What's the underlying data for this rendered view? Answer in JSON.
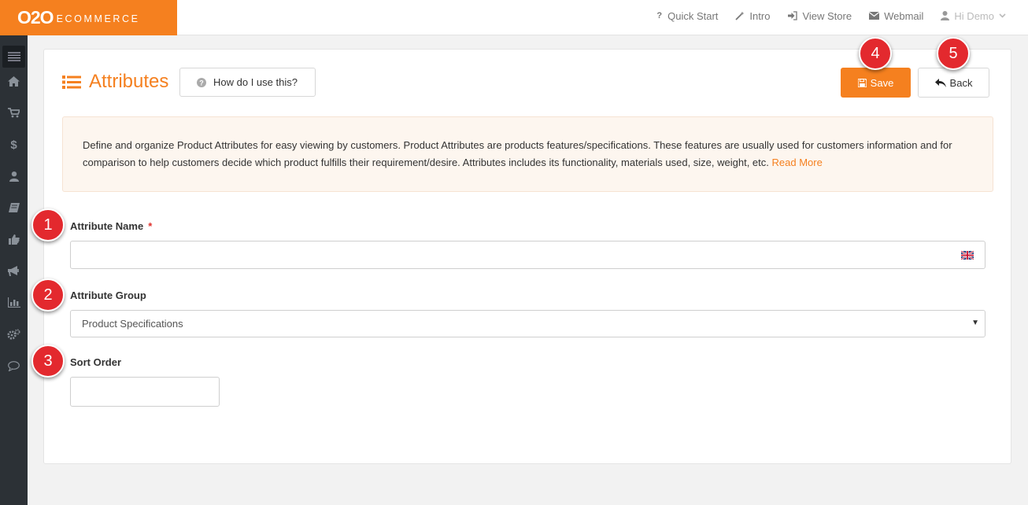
{
  "brand": {
    "main": "O2O",
    "sub": "ECOMMERCE"
  },
  "topnav": {
    "quick_start": "Quick Start",
    "intro": "Intro",
    "view_store": "View Store",
    "webmail": "Webmail",
    "user": "Hi Demo"
  },
  "sidebar": {
    "icons": [
      "menu-icon",
      "home-icon",
      "cart-icon",
      "dollar-icon",
      "user-icon",
      "book-icon",
      "thumbs-up-icon",
      "megaphone-icon",
      "bar-chart-icon",
      "gears-icon",
      "comment-icon"
    ]
  },
  "page": {
    "title": "Attributes",
    "help_label": "How do I use this?",
    "save_label": "Save",
    "back_label": "Back"
  },
  "info": {
    "text": "Define and organize Product Attributes for easy viewing by customers. Product Attributes are products features/specifications. These features are usually used for customers information and for comparison to help customers decide which product fulfills their requirement/desire. Attributes includes its functionality, materials used, size, weight, etc.",
    "read_more": "Read More"
  },
  "form": {
    "attribute_name_label": "Attribute Name",
    "required_mark": "*",
    "attribute_name_value": "",
    "attribute_group_label": "Attribute Group",
    "attribute_group_value": "Product Specifications",
    "sort_order_label": "Sort Order",
    "sort_order_value": ""
  },
  "callouts": [
    "1",
    "2",
    "3",
    "4",
    "5"
  ],
  "colors": {
    "accent": "#f5801f",
    "callout": "#e3292e",
    "sidebar": "#2c3136",
    "info_bg": "#fdf6ef"
  }
}
